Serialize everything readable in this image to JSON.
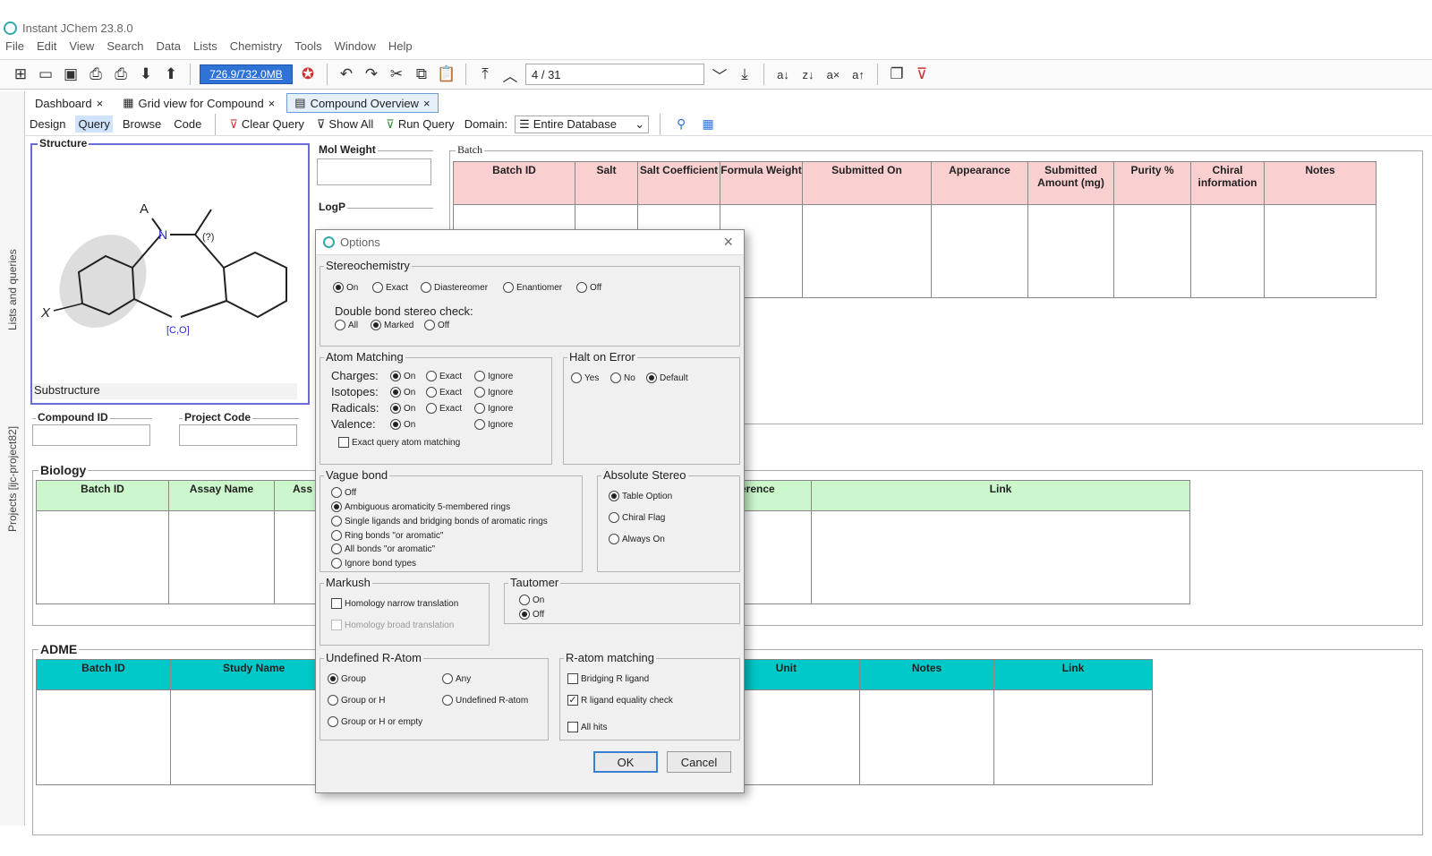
{
  "app": {
    "title": "Instant JChem 23.8.0"
  },
  "menu": [
    "File",
    "Edit",
    "View",
    "Search",
    "Data",
    "Lists",
    "Chemistry",
    "Tools",
    "Window",
    "Help"
  ],
  "toolbar": {
    "memory": "726.9/732.0MB",
    "record_nav": "4 / 31"
  },
  "tabs": [
    "Dashboard",
    "Grid view for Compound",
    "Compound Overview"
  ],
  "sidebar": {
    "lists": "Lists and queries",
    "projects": "Projects [ijc-project82]"
  },
  "form_toolbar": {
    "design": "Design",
    "query": "Query",
    "browse": "Browse",
    "code": "Code",
    "clear_query": "Clear Query",
    "show_all": "Show All",
    "run_query": "Run Query",
    "domain_label": "Domain:",
    "domain_value": "Entire Database"
  },
  "structure": {
    "title": "Structure",
    "mode": "Substructure",
    "atom_a": "A",
    "atom_n": "N",
    "atom_x": "X",
    "stereo": "(?)",
    "ring_label": "[C,O]"
  },
  "fields": {
    "mol_weight": "Mol Weight",
    "logp": "LogP",
    "compound_id": "Compound ID",
    "project_code": "Project Code"
  },
  "batch": {
    "title": "Batch",
    "columns": [
      "Batch ID",
      "Salt",
      "Salt Coefficient",
      "Formula Weight",
      "Submitted On",
      "Appearance",
      "Submitted Amount (mg)",
      "Purity %",
      "Chiral information",
      "Notes"
    ]
  },
  "biology": {
    "title": "Biology",
    "columns": [
      "Batch ID",
      "Assay Name",
      "Ass",
      "erence",
      "Link"
    ]
  },
  "adme": {
    "title": "ADME",
    "columns": [
      "Batch ID",
      "Study Name",
      "Unit",
      "Notes",
      "Link"
    ]
  },
  "colors": {
    "batch_header": "#f9cfd0",
    "bio_header": "#ccf7cc",
    "adme_header": "#00c8c8",
    "mem_bar": "#2f72d6"
  },
  "dialog": {
    "title": "Options",
    "stereochemistry": {
      "title": "Stereochemistry",
      "options": [
        "On",
        "Exact",
        "Diastereomer",
        "Enantiomer",
        "Off"
      ],
      "selected": "On",
      "double_bond_label": "Double bond stereo check:",
      "double_bond_options": [
        "All",
        "Marked",
        "Off"
      ],
      "double_bond_selected": "Marked"
    },
    "atom_matching": {
      "title": "Atom Matching",
      "charges": "Charges:",
      "isotopes": "Isotopes:",
      "radicals": "Radicals:",
      "valence": "Valence:",
      "on": "On",
      "exact": "Exact",
      "ignore": "Ignore",
      "exact_query": "Exact query atom matching"
    },
    "halt_on_error": {
      "title": "Halt on Error",
      "options": [
        "Yes",
        "No",
        "Default"
      ],
      "selected": "Default"
    },
    "vague_bond": {
      "title": "Vague bond",
      "options": [
        "Off",
        "Ambiguous aromaticity 5-membered rings",
        "Single ligands and bridging bonds of aromatic rings",
        "Ring bonds \"or aromatic\"",
        "All bonds \"or aromatic\"",
        "Ignore bond types"
      ],
      "selected": "Ambiguous aromaticity 5-membered rings"
    },
    "absolute_stereo": {
      "title": "Absolute Stereo",
      "options": [
        "Table Option",
        "Chiral Flag",
        "Always On"
      ],
      "selected": "Table Option"
    },
    "markush": {
      "title": "Markush",
      "narrow": "Homology narrow translation",
      "broad": "Homology broad translation"
    },
    "tautomer": {
      "title": "Tautomer",
      "options": [
        "On",
        "Off"
      ],
      "selected": "Off"
    },
    "undefined_r_atom": {
      "title": "Undefined R-Atom",
      "options": [
        "Group",
        "Any",
        "Group or H",
        "Undefined R-atom",
        "Group or H or empty"
      ],
      "selected": "Group"
    },
    "r_atom_matching": {
      "title": "R-atom matching",
      "bridging": "Bridging R ligand",
      "equality": "R ligand equality check",
      "all_hits": "All hits"
    },
    "ok": "OK",
    "cancel": "Cancel"
  }
}
